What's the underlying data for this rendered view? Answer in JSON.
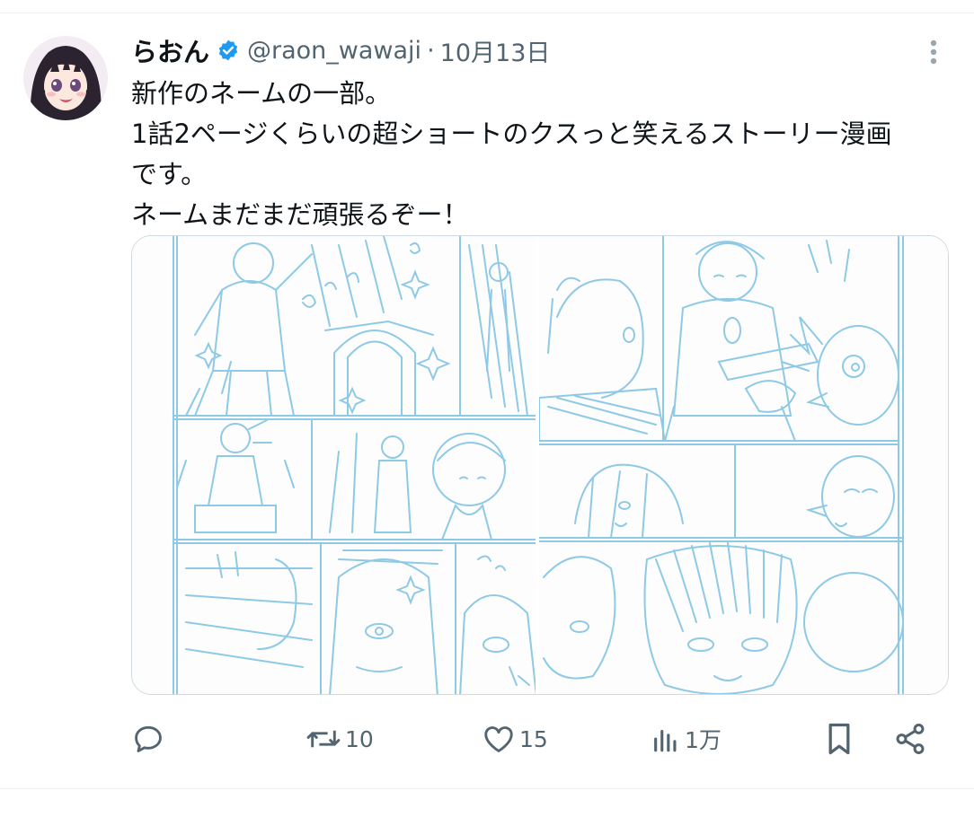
{
  "tweet": {
    "author": {
      "display_name": "らおん",
      "handle": "@raon_wawaji",
      "verified": true,
      "avatar_icon": "avatar-illustration"
    },
    "separator": "·",
    "date": "10月13日",
    "text_lines": [
      "新作のネームの一部。",
      "1話2ページくらいの超ショートのクスっと笑えるストーリー漫画",
      "です。",
      "ネームまだまだ頑張るぞー！"
    ],
    "media": {
      "images": [
        {
          "icon": "manga-sketch-page"
        },
        {
          "icon": "manga-sketch-page"
        }
      ],
      "sketch_color": "#8ec9e6"
    },
    "actions": {
      "reply": {
        "icon": "reply-icon",
        "count": ""
      },
      "retweet": {
        "icon": "retweet-icon",
        "count": "10"
      },
      "like": {
        "icon": "heart-icon",
        "count": "15"
      },
      "views": {
        "icon": "views-icon",
        "count": "1万"
      },
      "bookmark": {
        "icon": "bookmark-icon"
      },
      "share": {
        "icon": "share-icon"
      }
    }
  },
  "colors": {
    "text_primary": "#0f1419",
    "text_secondary": "#536471",
    "verified": "#1d9bf0",
    "border": "#cfd9de"
  }
}
